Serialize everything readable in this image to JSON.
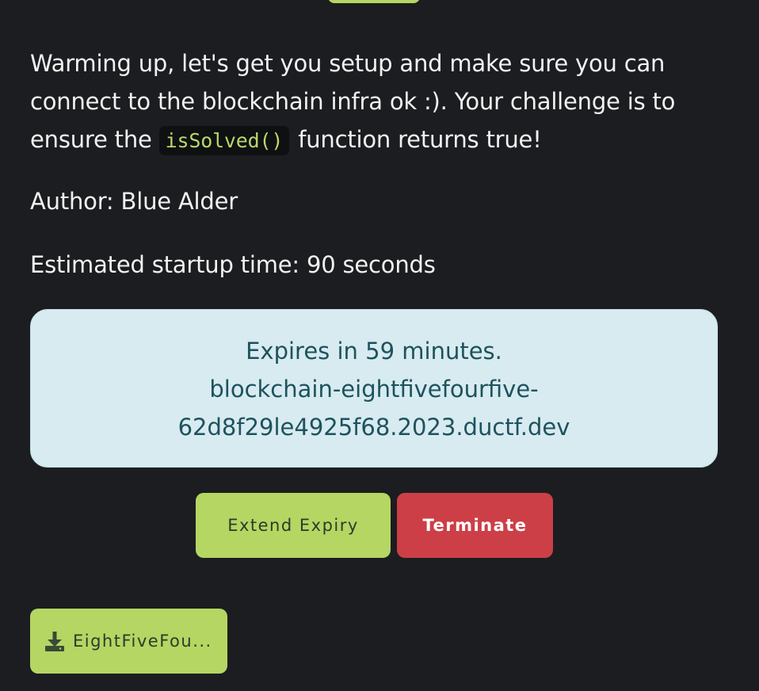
{
  "description": {
    "text_1": "Warming up, let's get you setup and make sure you can connect to the blockchain infra ok :). Your challenge is to ensure the ",
    "code": "isSolved()",
    "text_2": " function returns true!"
  },
  "author": "Author: Blue Alder",
  "startup_time": "Estimated startup time: 90 seconds",
  "instance": {
    "expiry": "Expires in 59 minutes.",
    "host_line_1": "blockchain-eightfivefourfive-",
    "host_line_2": "62d8f29le4925f68.2023.ductf.dev"
  },
  "buttons": {
    "extend": "Extend Expiry",
    "terminate": "Terminate"
  },
  "download": {
    "icon": "download-icon",
    "label": "EightFiveFou..."
  },
  "colors": {
    "background": "#1c1d20",
    "accent_green": "#b5d663",
    "danger_red": "#cd3f47",
    "info_bg": "#d7ebf0",
    "info_text": "#1e525e"
  }
}
